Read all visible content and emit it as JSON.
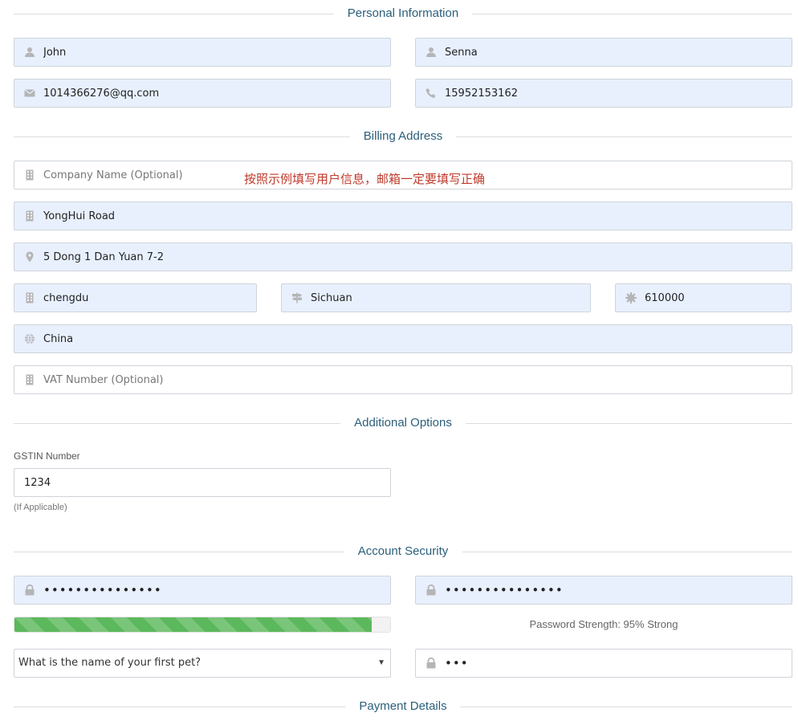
{
  "sections": {
    "personal": "Personal Information",
    "billing": "Billing Address",
    "additional": "Additional Options",
    "security": "Account Security",
    "payment": "Payment Details"
  },
  "personal": {
    "first_name": "John",
    "last_name": "Senna",
    "email": "1014366276@qq.com",
    "phone": "15952153162"
  },
  "billing": {
    "company_placeholder": "Company Name (Optional)",
    "notice": "按照示例填写用户信息，邮箱一定要填写正确",
    "address1": "YongHui Road",
    "address2": "5 Dong 1 Dan Yuan 7-2",
    "city": "chengdu",
    "state": "Sichuan",
    "postcode": "610000",
    "country": "China",
    "vat_placeholder": "VAT Number (Optional)"
  },
  "additional": {
    "gstin_label": "GSTIN Number",
    "gstin_value": "1234",
    "gstin_hint": "(If Applicable)"
  },
  "security": {
    "password": "•••••••••••••••",
    "password_confirm": "•••••••••••••••",
    "strength_percent": 95,
    "strength_label": "Password Strength: 95% Strong",
    "question_selected": "What is the name of your first pet?",
    "answer": "•••"
  },
  "icons": {
    "person": "user-icon",
    "email": "envelope-icon",
    "phone": "phone-icon",
    "building": "building-icon",
    "location": "map-marker-icon",
    "signpost": "signpost-icon",
    "gear": "certificate-icon",
    "globe": "globe-icon",
    "lock": "lock-icon"
  },
  "colors": {
    "section_title": "#2b5f7a",
    "autofill_bg": "#e8f0fe",
    "progress": "#5cb85c",
    "notice": "#c0392b",
    "icon": "#b5b5b5"
  }
}
